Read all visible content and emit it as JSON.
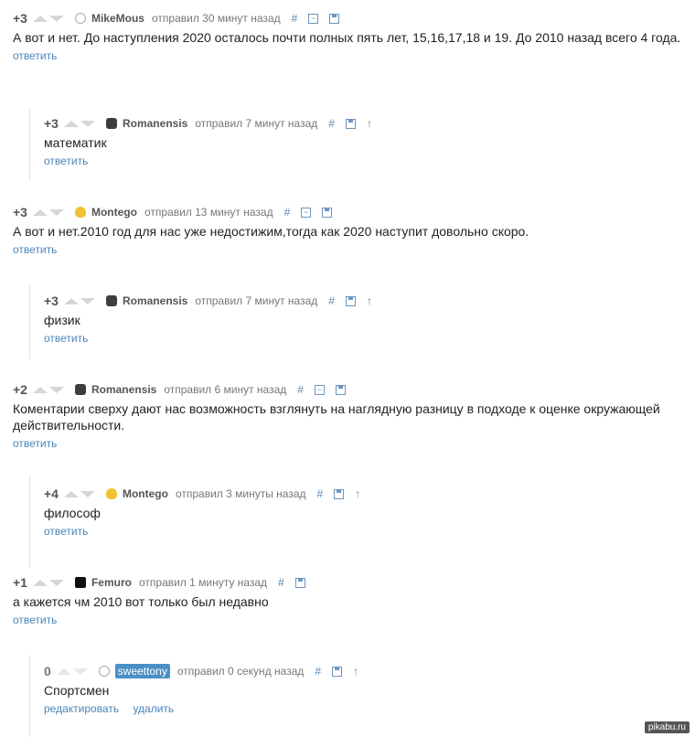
{
  "comments": [
    {
      "rating": "+3",
      "user": "MikeMous",
      "time": "отправил 30 минут назад",
      "text": "А вот и нет. До наступления 2020 осталось почти полных пять лет, 15,16,17,18 и 19. До 2010 назад всего 4 года.",
      "reply": "ответить"
    },
    {
      "rating": "+3",
      "user": "Romanensis",
      "time": "отправил 7 минут назад",
      "text": "математик",
      "reply": "ответить"
    },
    {
      "rating": "+3",
      "user": "Montego",
      "time": "отправил 13 минут назад",
      "text": "А вот и нет.2010 год для нас уже недостижим,тогда как 2020 наступит довольно скоро.",
      "reply": "ответить"
    },
    {
      "rating": "+3",
      "user": "Romanensis",
      "time": "отправил 7 минут назад",
      "text": "физик",
      "reply": "ответить"
    },
    {
      "rating": "+2",
      "user": "Romanensis",
      "time": "отправил 6 минут назад",
      "text": "Коментарии сверху дают нас возможность взглянуть на наглядную разницу в подходе к оценке окружающей действительности.",
      "reply": "ответить"
    },
    {
      "rating": "+4",
      "user": "Montego",
      "time": "отправил 3 минуты назад",
      "text": "философ",
      "reply": "ответить"
    },
    {
      "rating": "+1",
      "user": "Femuro",
      "time": "отправил 1 минуту назад",
      "text": "а кажется чм 2010 вот только был недавно",
      "reply": "ответить"
    },
    {
      "rating": "0",
      "user": "sweettony",
      "time": "отправил 0 секунд назад",
      "text": "Спортсмен",
      "edit": "редактировать",
      "delete": "удалить"
    }
  ],
  "icons": {
    "hash": "#",
    "collapse": "−",
    "up": "↑"
  },
  "watermark": "pikabu.ru"
}
